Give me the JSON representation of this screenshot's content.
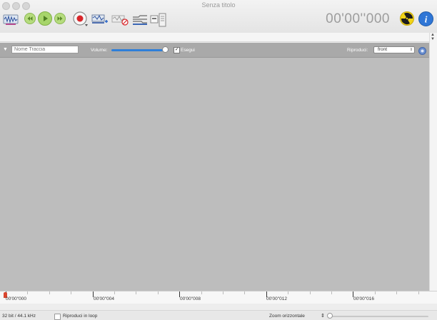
{
  "window": {
    "title": "Senza titolo"
  },
  "toolbar": {
    "time_display": "00'00''000",
    "icons": [
      "waveform-icon",
      "rewind-icon",
      "play-icon",
      "fast-forward-icon",
      "record-icon",
      "add-track-icon",
      "delete-track-icon",
      "effects-icon",
      "export-icon",
      "radioactive-icon",
      "info-icon"
    ]
  },
  "track": {
    "name_placeholder": "Nome Traccia",
    "volume_label": "Volume:",
    "volume_level": 0.95,
    "play_label": "Esegui",
    "play_checked": true,
    "output_label": "Riproduci:",
    "output_value": "front"
  },
  "timeline": {
    "labels": [
      "00'00''000",
      "00'00''004",
      "00'00''008",
      "00'00''012",
      "00'00''016"
    ]
  },
  "status": {
    "format": "32 bit / 44.1 kHz",
    "loop_label": "Riproduci in loop",
    "zoom_label": "Zoom orizzontale"
  },
  "colors": {
    "track_area": "#bdbdbd",
    "track_header": "#a9a9a9",
    "volume_accent": "#2f7fd9",
    "playhead": "#d9462f"
  }
}
